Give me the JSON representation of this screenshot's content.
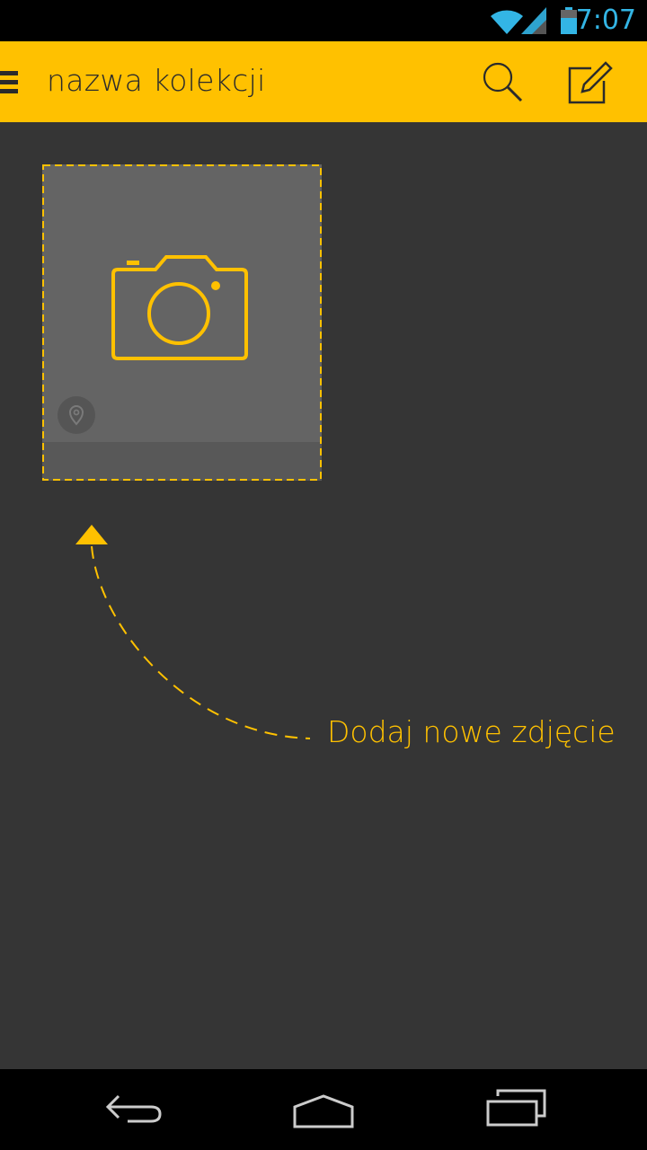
{
  "status_bar": {
    "time": "7:07",
    "icons": [
      "wifi-icon",
      "signal-icon",
      "battery-icon"
    ],
    "accent_color": "#33b5e5"
  },
  "action_bar": {
    "title": "nazwa kolekcji",
    "background_color": "#ffc100",
    "icons": [
      "menu-icon",
      "search-icon",
      "compose-icon"
    ]
  },
  "content": {
    "tile_icons": [
      "camera-icon",
      "location-pin-icon"
    ],
    "hint_text": "Dodaj nowe zdjęcie",
    "accent_color": "#ffc100",
    "background_color": "#353535"
  },
  "nav_bar": {
    "icons": [
      "back-icon",
      "home-icon",
      "recent-apps-icon"
    ]
  }
}
